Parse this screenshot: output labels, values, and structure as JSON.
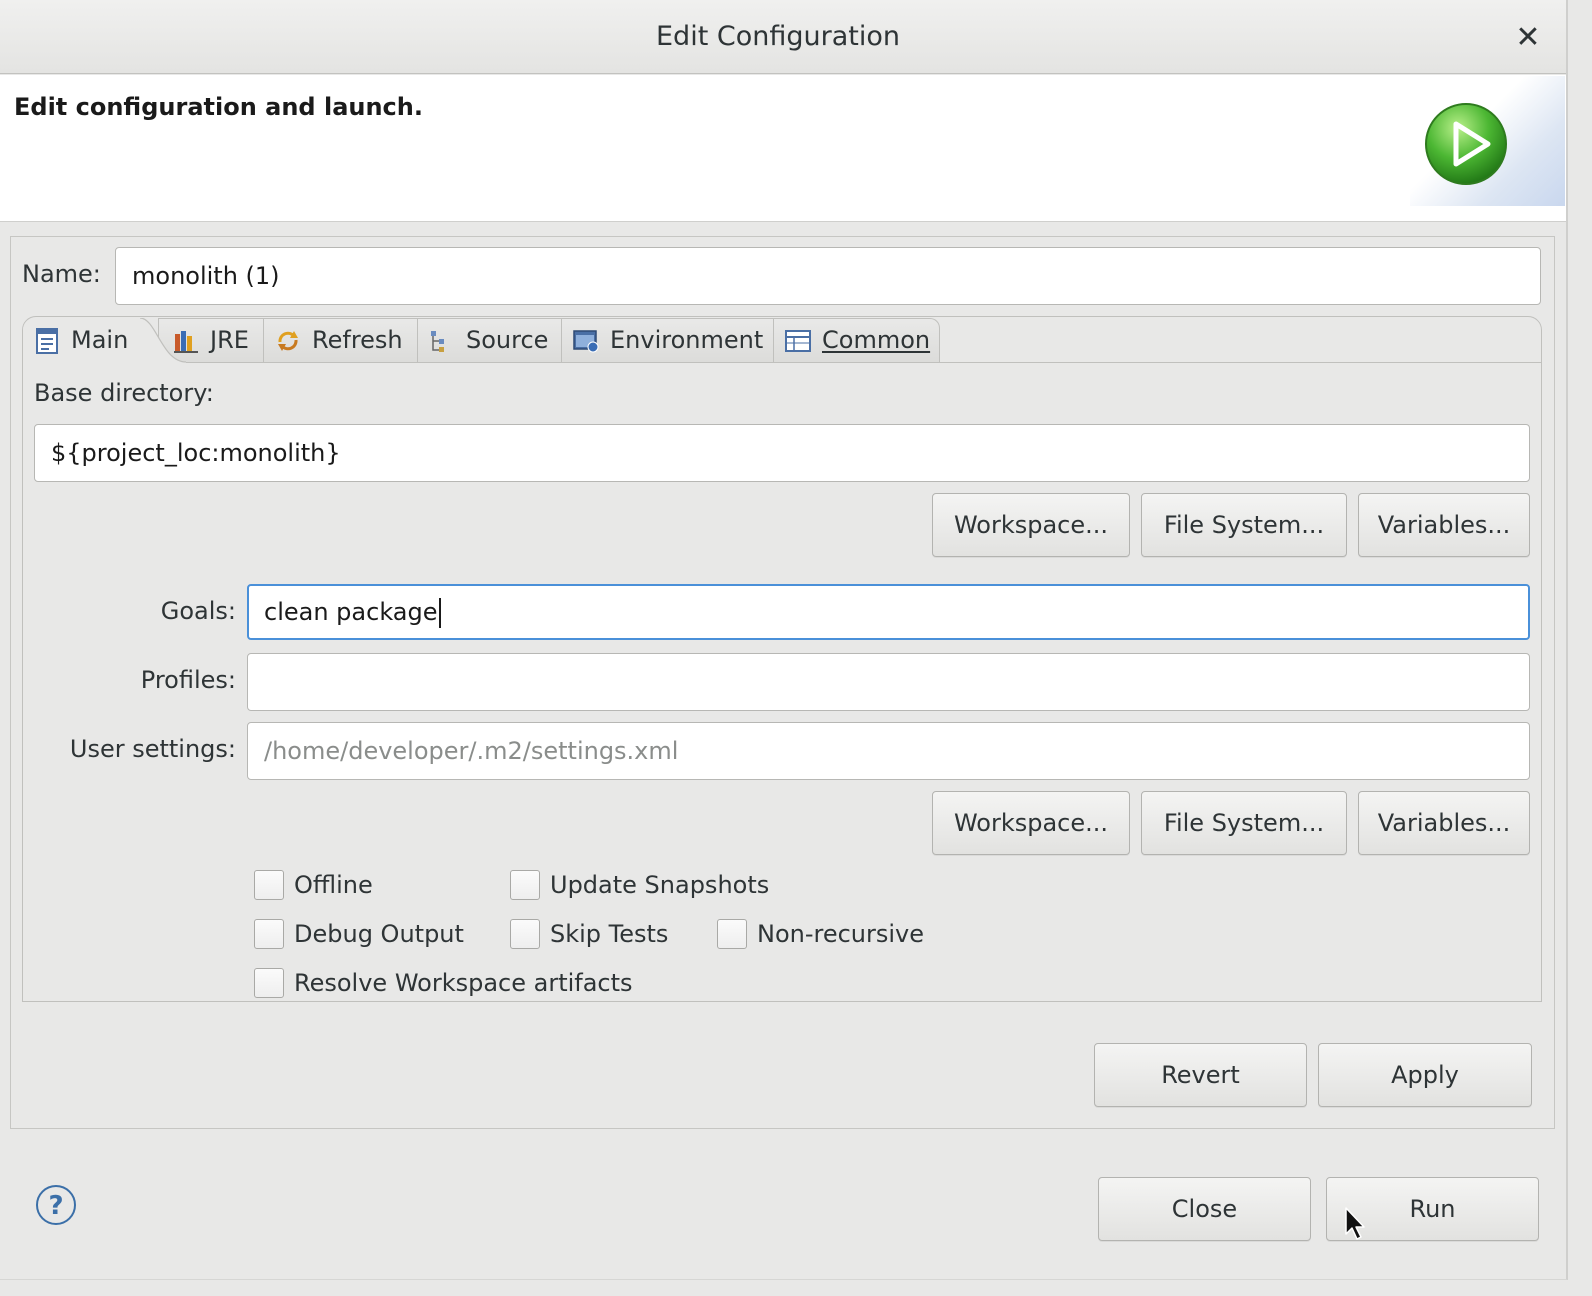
{
  "window": {
    "title": "Edit Configuration"
  },
  "banner": {
    "message": "Edit configuration and launch."
  },
  "name": {
    "label": "Name:",
    "value": "monolith (1)"
  },
  "tabs": [
    {
      "label": "Main",
      "icon": "main-tab-icon",
      "active": true
    },
    {
      "label": "JRE",
      "icon": "jre-icon"
    },
    {
      "label": "Refresh",
      "icon": "refresh-icon"
    },
    {
      "label": "Source",
      "icon": "source-icon"
    },
    {
      "label": "Environment",
      "icon": "environment-icon"
    },
    {
      "label": "Common",
      "icon": "common-icon"
    }
  ],
  "main": {
    "base_dir_label": "Base directory:",
    "base_dir_value": "${project_loc:monolith}",
    "base_buttons": {
      "workspace": "Workspace...",
      "filesystem": "File System...",
      "variables": "Variables..."
    },
    "goals_label": "Goals:",
    "goals_value": "clean package",
    "profiles_label": "Profiles:",
    "profiles_value": "",
    "user_settings_label": "User settings:",
    "user_settings_placeholder": "/home/developer/.m2/settings.xml",
    "settings_buttons": {
      "workspace": "Workspace...",
      "filesystem": "File System...",
      "variables": "Variables..."
    },
    "checkboxes": {
      "offline": "Offline",
      "update_snapshots": "Update Snapshots",
      "debug_output": "Debug Output",
      "skip_tests": "Skip Tests",
      "non_recursive": "Non-recursive",
      "resolve_workspace": "Resolve Workspace artifacts"
    }
  },
  "actions": {
    "revert": "Revert",
    "apply": "Apply"
  },
  "footer": {
    "help": "?",
    "close": "Close",
    "run": "Run"
  },
  "colors": {
    "focus_border": "#4a90d9",
    "run_icon_green": "#3aa82a"
  }
}
